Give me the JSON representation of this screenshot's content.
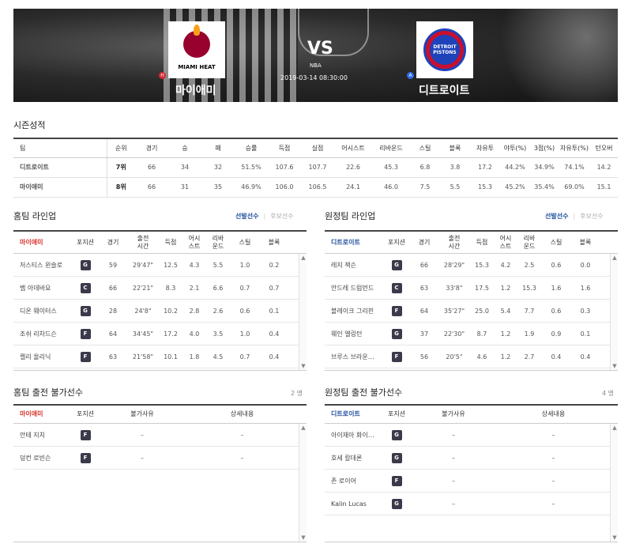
{
  "header": {
    "home_team": "마이애미",
    "away_team": "디트로이트",
    "home_badge": "H",
    "away_badge": "A",
    "vs": "VS",
    "league": "NBA",
    "datetime": "2019-03-14 08:30:00",
    "home_logo_text": "MIAMI HEAT",
    "away_logo_text": "DETROIT PISTONS"
  },
  "season": {
    "title": "시즌성적",
    "columns": [
      "팀",
      "순위",
      "경기",
      "승",
      "패",
      "승률",
      "득점",
      "실점",
      "어시스트",
      "리바운드",
      "스틸",
      "블록",
      "자유투",
      "야투(%)",
      "3점(%)",
      "자유투(%)",
      "턴오버"
    ],
    "rows": [
      {
        "team": "디트로이트",
        "color": "blue",
        "cells": [
          "7위",
          "66",
          "34",
          "32",
          "51.5%",
          "107.6",
          "107.7",
          "22.6",
          "45.3",
          "6.8",
          "3.8",
          "17.2",
          "44.2%",
          "34.9%",
          "74.1%",
          "14.2"
        ]
      },
      {
        "team": "마이애미",
        "color": "red",
        "cells": [
          "8위",
          "66",
          "31",
          "35",
          "46.9%",
          "106.0",
          "106.5",
          "24.1",
          "46.0",
          "7.5",
          "5.5",
          "15.3",
          "45.2%",
          "35.4%",
          "69.0%",
          "15.1"
        ]
      }
    ]
  },
  "home_lineup": {
    "title": "홈팀 라인업",
    "toggle_on": "선발선수",
    "toggle_off": "후보선수",
    "team": "마이애미",
    "columns": [
      "포지션",
      "경기",
      "출전\n시간",
      "득점",
      "어시\n스트",
      "리바\n운드",
      "스틸",
      "블록"
    ],
    "rows": [
      {
        "name": "저스티스 윈슬로",
        "pos": "G",
        "cells": [
          "59",
          "29'47\"",
          "12.5",
          "4.3",
          "5.5",
          "1.0",
          "0.2"
        ]
      },
      {
        "name": "뱀 아데바요",
        "pos": "C",
        "cells": [
          "66",
          "22'21\"",
          "8.3",
          "2.1",
          "6.6",
          "0.7",
          "0.7"
        ]
      },
      {
        "name": "디온 웨이터스",
        "pos": "G",
        "cells": [
          "28",
          "24'8\"",
          "10.2",
          "2.8",
          "2.6",
          "0.6",
          "0.1"
        ]
      },
      {
        "name": "조쉬 리차드슨",
        "pos": "F",
        "cells": [
          "64",
          "34'45\"",
          "17.2",
          "4.0",
          "3.5",
          "1.0",
          "0.4"
        ]
      },
      {
        "name": "켈리 올리닉",
        "pos": "F",
        "cells": [
          "63",
          "21'58\"",
          "10.1",
          "1.8",
          "4.5",
          "0.7",
          "0.4"
        ]
      }
    ]
  },
  "away_lineup": {
    "title": "원정팀 라인업",
    "toggle_on": "선발선수",
    "toggle_off": "후보선수",
    "team": "디트로이트",
    "columns": [
      "포지션",
      "경기",
      "출전\n시간",
      "득점",
      "어시\n스트",
      "리바\n운드",
      "스틸",
      "블록"
    ],
    "rows": [
      {
        "name": "레지 잭슨",
        "pos": "G",
        "cells": [
          "66",
          "28'29\"",
          "15.3",
          "4.2",
          "2.5",
          "0.6",
          "0.0"
        ]
      },
      {
        "name": "안드레 드럼먼드",
        "pos": "C",
        "cells": [
          "63",
          "33'8\"",
          "17.5",
          "1.2",
          "15.3",
          "1.6",
          "1.6"
        ]
      },
      {
        "name": "블레이크 그리핀",
        "pos": "F",
        "cells": [
          "64",
          "35'27\"",
          "25.0",
          "5.4",
          "7.7",
          "0.6",
          "0.3"
        ]
      },
      {
        "name": "웨인 엘링턴",
        "pos": "G",
        "cells": [
          "37",
          "22'30\"",
          "8.7",
          "1.2",
          "1.9",
          "0.9",
          "0.1"
        ]
      },
      {
        "name": "브루스 브라운…",
        "pos": "F",
        "cells": [
          "56",
          "20'5\"",
          "4.6",
          "1.2",
          "2.7",
          "0.4",
          "0.4"
        ]
      }
    ]
  },
  "home_out": {
    "title": "홈팀 출전 불가선수",
    "count": "2 명",
    "team": "마이애미",
    "columns": [
      "포지션",
      "불가사유",
      "상세내용"
    ],
    "rows": [
      {
        "name": "안테 지치",
        "pos": "F",
        "reason": "–",
        "detail": "–"
      },
      {
        "name": "덩컨 로빈슨",
        "pos": "F",
        "reason": "–",
        "detail": "–"
      }
    ]
  },
  "away_out": {
    "title": "원정팀 출전 불가선수",
    "count": "4 명",
    "team": "디트로이트",
    "columns": [
      "포지션",
      "불가사유",
      "상세내용"
    ],
    "rows": [
      {
        "name": "아이재아 화이…",
        "pos": "G",
        "reason": "–",
        "detail": "–"
      },
      {
        "name": "호세 칼데론",
        "pos": "G",
        "reason": "–",
        "detail": "–"
      },
      {
        "name": "존 로이어",
        "pos": "F",
        "reason": "–",
        "detail": "–"
      },
      {
        "name": "Kalin Lucas",
        "pos": "G",
        "reason": "–",
        "detail": "–"
      }
    ]
  }
}
